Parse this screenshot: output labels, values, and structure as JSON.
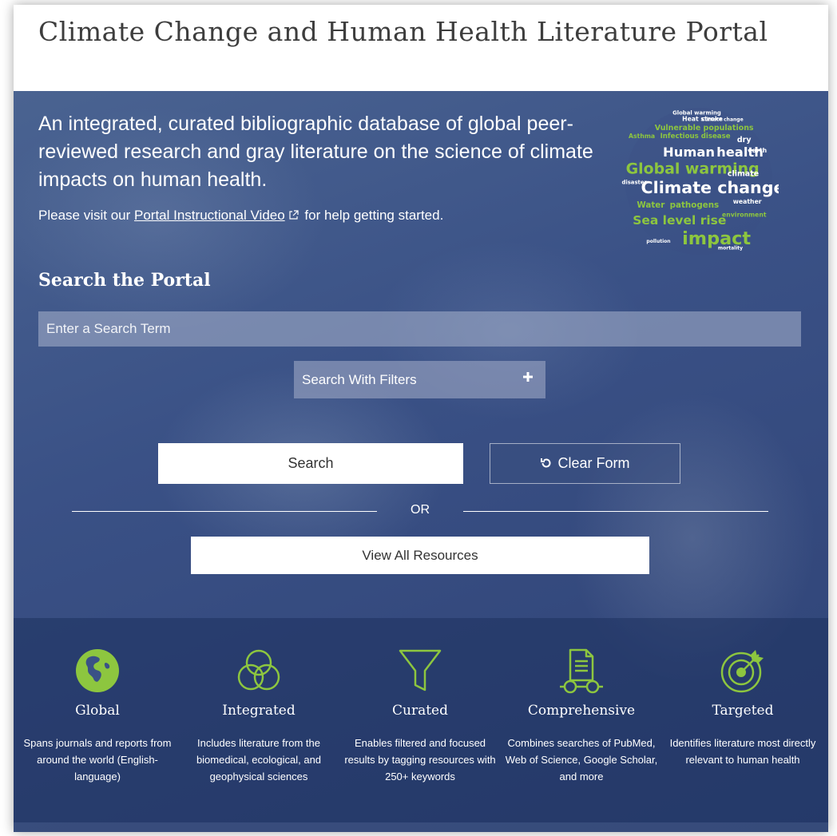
{
  "header": {
    "title": "Climate Change and Human Health Literature Portal"
  },
  "hero": {
    "tagline": "An integrated, curated bibliographic database of global peer-reviewed research and gray literature on the science of climate impacts on human health.",
    "help_prefix": "Please visit our ",
    "help_link": "Portal Instructional Video",
    "help_suffix": " for help getting started.",
    "word_cloud": {
      "words": [
        "Global warming",
        "Heat stroke",
        "Climate change",
        "Vulnerable populations",
        "Asthma",
        "Infectious disease",
        "dry",
        "Human",
        "health",
        "earth",
        "Global warming",
        "climate",
        "Climate change",
        "Water",
        "pathogens",
        "weather",
        "Sea level rise",
        "impact",
        "environment",
        "disaster",
        "pollution",
        "mortality"
      ],
      "accent": "#8dc63f"
    }
  },
  "search": {
    "heading": "Search the Portal",
    "placeholder": "Enter a Search Term",
    "filters_label": "Search With Filters",
    "search_label": "Search",
    "clear_label": "Clear Form",
    "or_label": "OR",
    "view_all_label": "View All Resources"
  },
  "features": [
    {
      "icon": "globe-icon",
      "title": "Global",
      "desc": "Spans journals and reports from around the world (English-language)"
    },
    {
      "icon": "venn-diagram-icon",
      "title": "Integrated",
      "desc": "Includes literature from the biomedical, ecological, and geophysical sciences"
    },
    {
      "icon": "funnel-icon",
      "title": "Curated",
      "desc": "Enables filtered and focused results by tagging resources with 250+ keywords"
    },
    {
      "icon": "document-glasses-icon",
      "title": "Comprehensive",
      "desc": "Combines searches of PubMed, Web of Science, Google Scholar, and more"
    },
    {
      "icon": "target-icon",
      "title": "Targeted",
      "desc": "Identifies literature most directly relevant to human health"
    }
  ],
  "colors": {
    "accent_green": "#8dc63f",
    "hero_blue": "#3a5186",
    "title_gray": "#3d3d3d"
  }
}
